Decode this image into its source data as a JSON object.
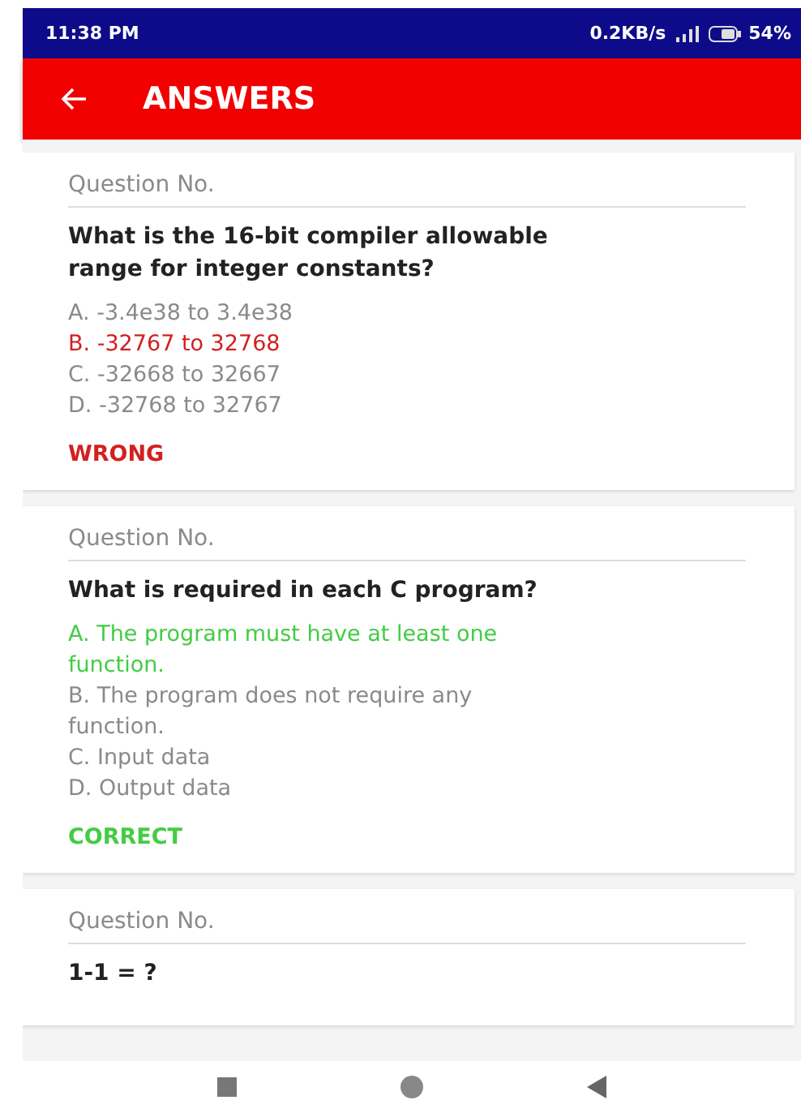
{
  "status_bar": {
    "time": "11:38 PM",
    "speed": "0.2KB/s",
    "battery": "54%"
  },
  "app_bar": {
    "title": "ANSWERS"
  },
  "questions": [
    {
      "label": "Question No.",
      "text": "What is the 16-bit compiler allowable range for integer constants?",
      "options": [
        {
          "text": "A. -3.4e38 to 3.4e38",
          "kind": "plain"
        },
        {
          "text": "B. -32767 to 32768",
          "kind": "wrong"
        },
        {
          "text": "C. -32668 to 32667",
          "kind": "plain"
        },
        {
          "text": "D. -32768 to 32767",
          "kind": "plain"
        }
      ],
      "result": {
        "text": "WRONG",
        "correct": false
      }
    },
    {
      "label": "Question No.",
      "text": "What is required in each C program?",
      "options": [
        {
          "text": "A. The program must have at least one function.",
          "kind": "correct"
        },
        {
          "text": "B. The program does not require any function.",
          "kind": "plain"
        },
        {
          "text": "C. Input data",
          "kind": "plain"
        },
        {
          "text": "D. Output data",
          "kind": "plain"
        }
      ],
      "result": {
        "text": "CORRECT",
        "correct": true
      }
    },
    {
      "label": "Question No.",
      "text": "1-1 = ?"
    }
  ]
}
